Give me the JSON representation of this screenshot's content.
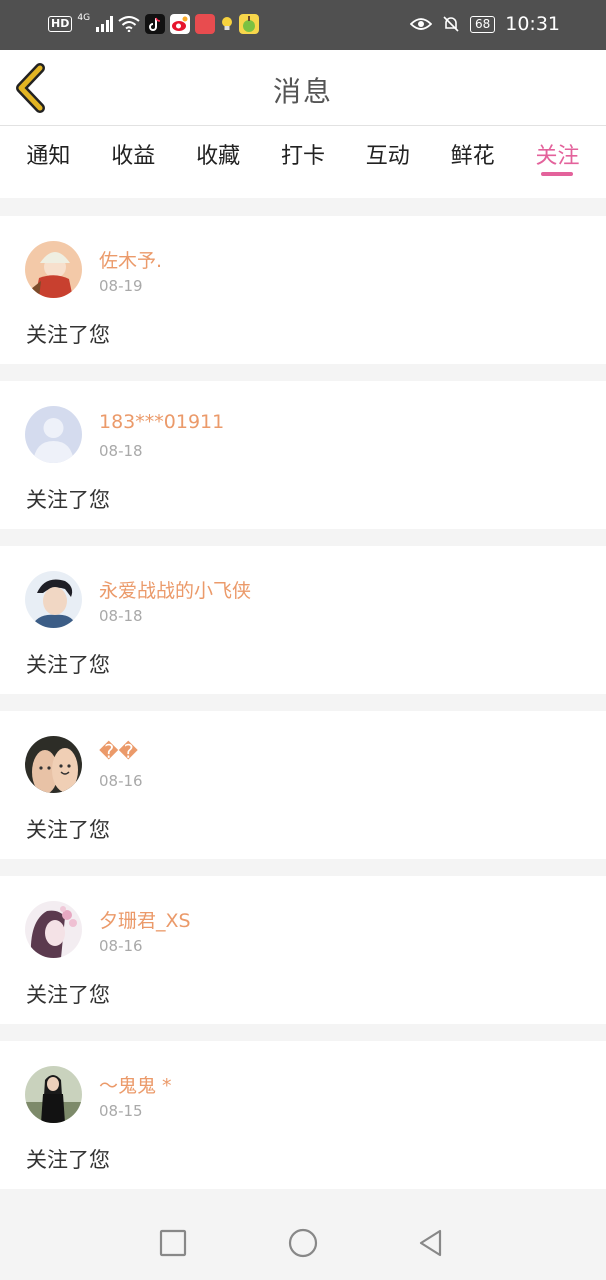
{
  "status_bar": {
    "hd": "HD",
    "network": "4G",
    "battery": "68",
    "time": "10:31"
  },
  "header": {
    "title": "消息"
  },
  "tabs": [
    {
      "label": "通知",
      "active": false
    },
    {
      "label": "收益",
      "active": false
    },
    {
      "label": "收藏",
      "active": false
    },
    {
      "label": "打卡",
      "active": false
    },
    {
      "label": "互动",
      "active": false
    },
    {
      "label": "鲜花",
      "active": false
    },
    {
      "label": "关注",
      "active": true
    }
  ],
  "messages": [
    {
      "username": "佐木予.",
      "date": "08-19",
      "text": "关注了您",
      "avatar": "girl-hat-avatar"
    },
    {
      "username": "183***01911",
      "date": "08-18",
      "text": "关注了您",
      "avatar": "default-avatar"
    },
    {
      "username": "永爱战战的小飞侠",
      "date": "08-18",
      "text": "关注了您",
      "avatar": "boy-portrait-avatar"
    },
    {
      "username": "��",
      "date": "08-16",
      "text": "关注了您",
      "avatar": "fingers-faces-avatar"
    },
    {
      "username": "夕珊君_XS",
      "date": "08-16",
      "text": "关注了您",
      "avatar": "girl-flowers-avatar"
    },
    {
      "username": "～鬼鬼 *",
      "date": "08-15",
      "text": "关注了您",
      "avatar": "girl-outdoor-avatar"
    }
  ],
  "colors": {
    "accent": "#e3629b",
    "username": "#eb9a6a",
    "back_arrow": "#e2b423"
  }
}
